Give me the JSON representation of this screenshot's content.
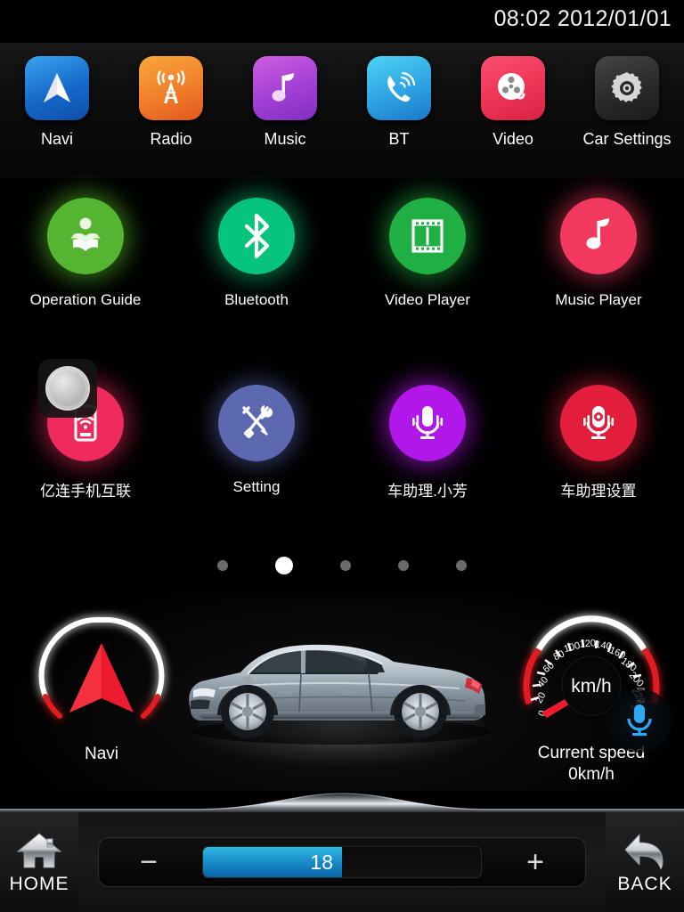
{
  "status_bar": {
    "time": "08:02",
    "date": "2012/01/01",
    "clock_text": "08:02 2012/01/01"
  },
  "top_dock": {
    "items": [
      {
        "label": "Navi",
        "icon": "navigation-arrow-icon",
        "color": "#1668c9"
      },
      {
        "label": "Radio",
        "icon": "radio-tower-icon",
        "color": "#f2822c"
      },
      {
        "label": "Music",
        "icon": "music-note-icon",
        "color": "#a13fd4"
      },
      {
        "label": "BT",
        "icon": "phone-bluetooth-icon",
        "color": "#2da3e3"
      },
      {
        "label": "Video",
        "icon": "film-reel-icon",
        "color": "#ee3456"
      },
      {
        "label": "Car Settings",
        "icon": "gear-icon",
        "color": "#2a2a2a"
      }
    ]
  },
  "app_grid": {
    "row1": [
      {
        "label": "Operation Guide",
        "icon": "reading-person-icon",
        "color": "#55b431"
      },
      {
        "label": "Bluetooth",
        "icon": "bluetooth-icon",
        "color": "#06c47e"
      },
      {
        "label": "Video Player",
        "icon": "film-strip-icon",
        "color": "#1faf42"
      },
      {
        "label": "Music Player",
        "icon": "music-note-icon",
        "color": "#f2385c"
      }
    ],
    "row2": [
      {
        "label": "亿连手机互联",
        "icon": "phone-link-icon",
        "color": "#ef2a5c"
      },
      {
        "label": "Setting",
        "icon": "tools-icon",
        "color": "#5c68b0"
      },
      {
        "label": "车助理.小芳",
        "icon": "microphone-icon",
        "color": "#b117e8"
      },
      {
        "label": "车助理设置",
        "icon": "microphone-gear-icon",
        "color": "#e31e3c"
      }
    ]
  },
  "page_indicator": {
    "total": 5,
    "active_index": 1
  },
  "voice_fab": {
    "icon": "microphone-icon",
    "color": "#2fa8ef"
  },
  "dashboard": {
    "navi": {
      "caption": "Navi",
      "icon": "navigation-arrow-icon"
    },
    "car": {
      "icon": "sedan-car-side-icon"
    },
    "speedometer": {
      "caption_line1": "Current speed",
      "caption_line2": "0km/h",
      "unit_label": "km/h",
      "current_value": 0,
      "ticks": [
        0,
        20,
        40,
        60,
        80,
        100,
        120,
        140,
        160,
        180,
        200,
        220,
        240
      ],
      "min": 0,
      "max": 240
    }
  },
  "bottom_bar": {
    "home": {
      "label": "HOME",
      "icon": "home-icon"
    },
    "back": {
      "label": "BACK",
      "icon": "back-arrow-icon"
    },
    "volume": {
      "value": "18",
      "minus_label": "−",
      "plus_label": "+",
      "fill_percent": 50
    }
  }
}
